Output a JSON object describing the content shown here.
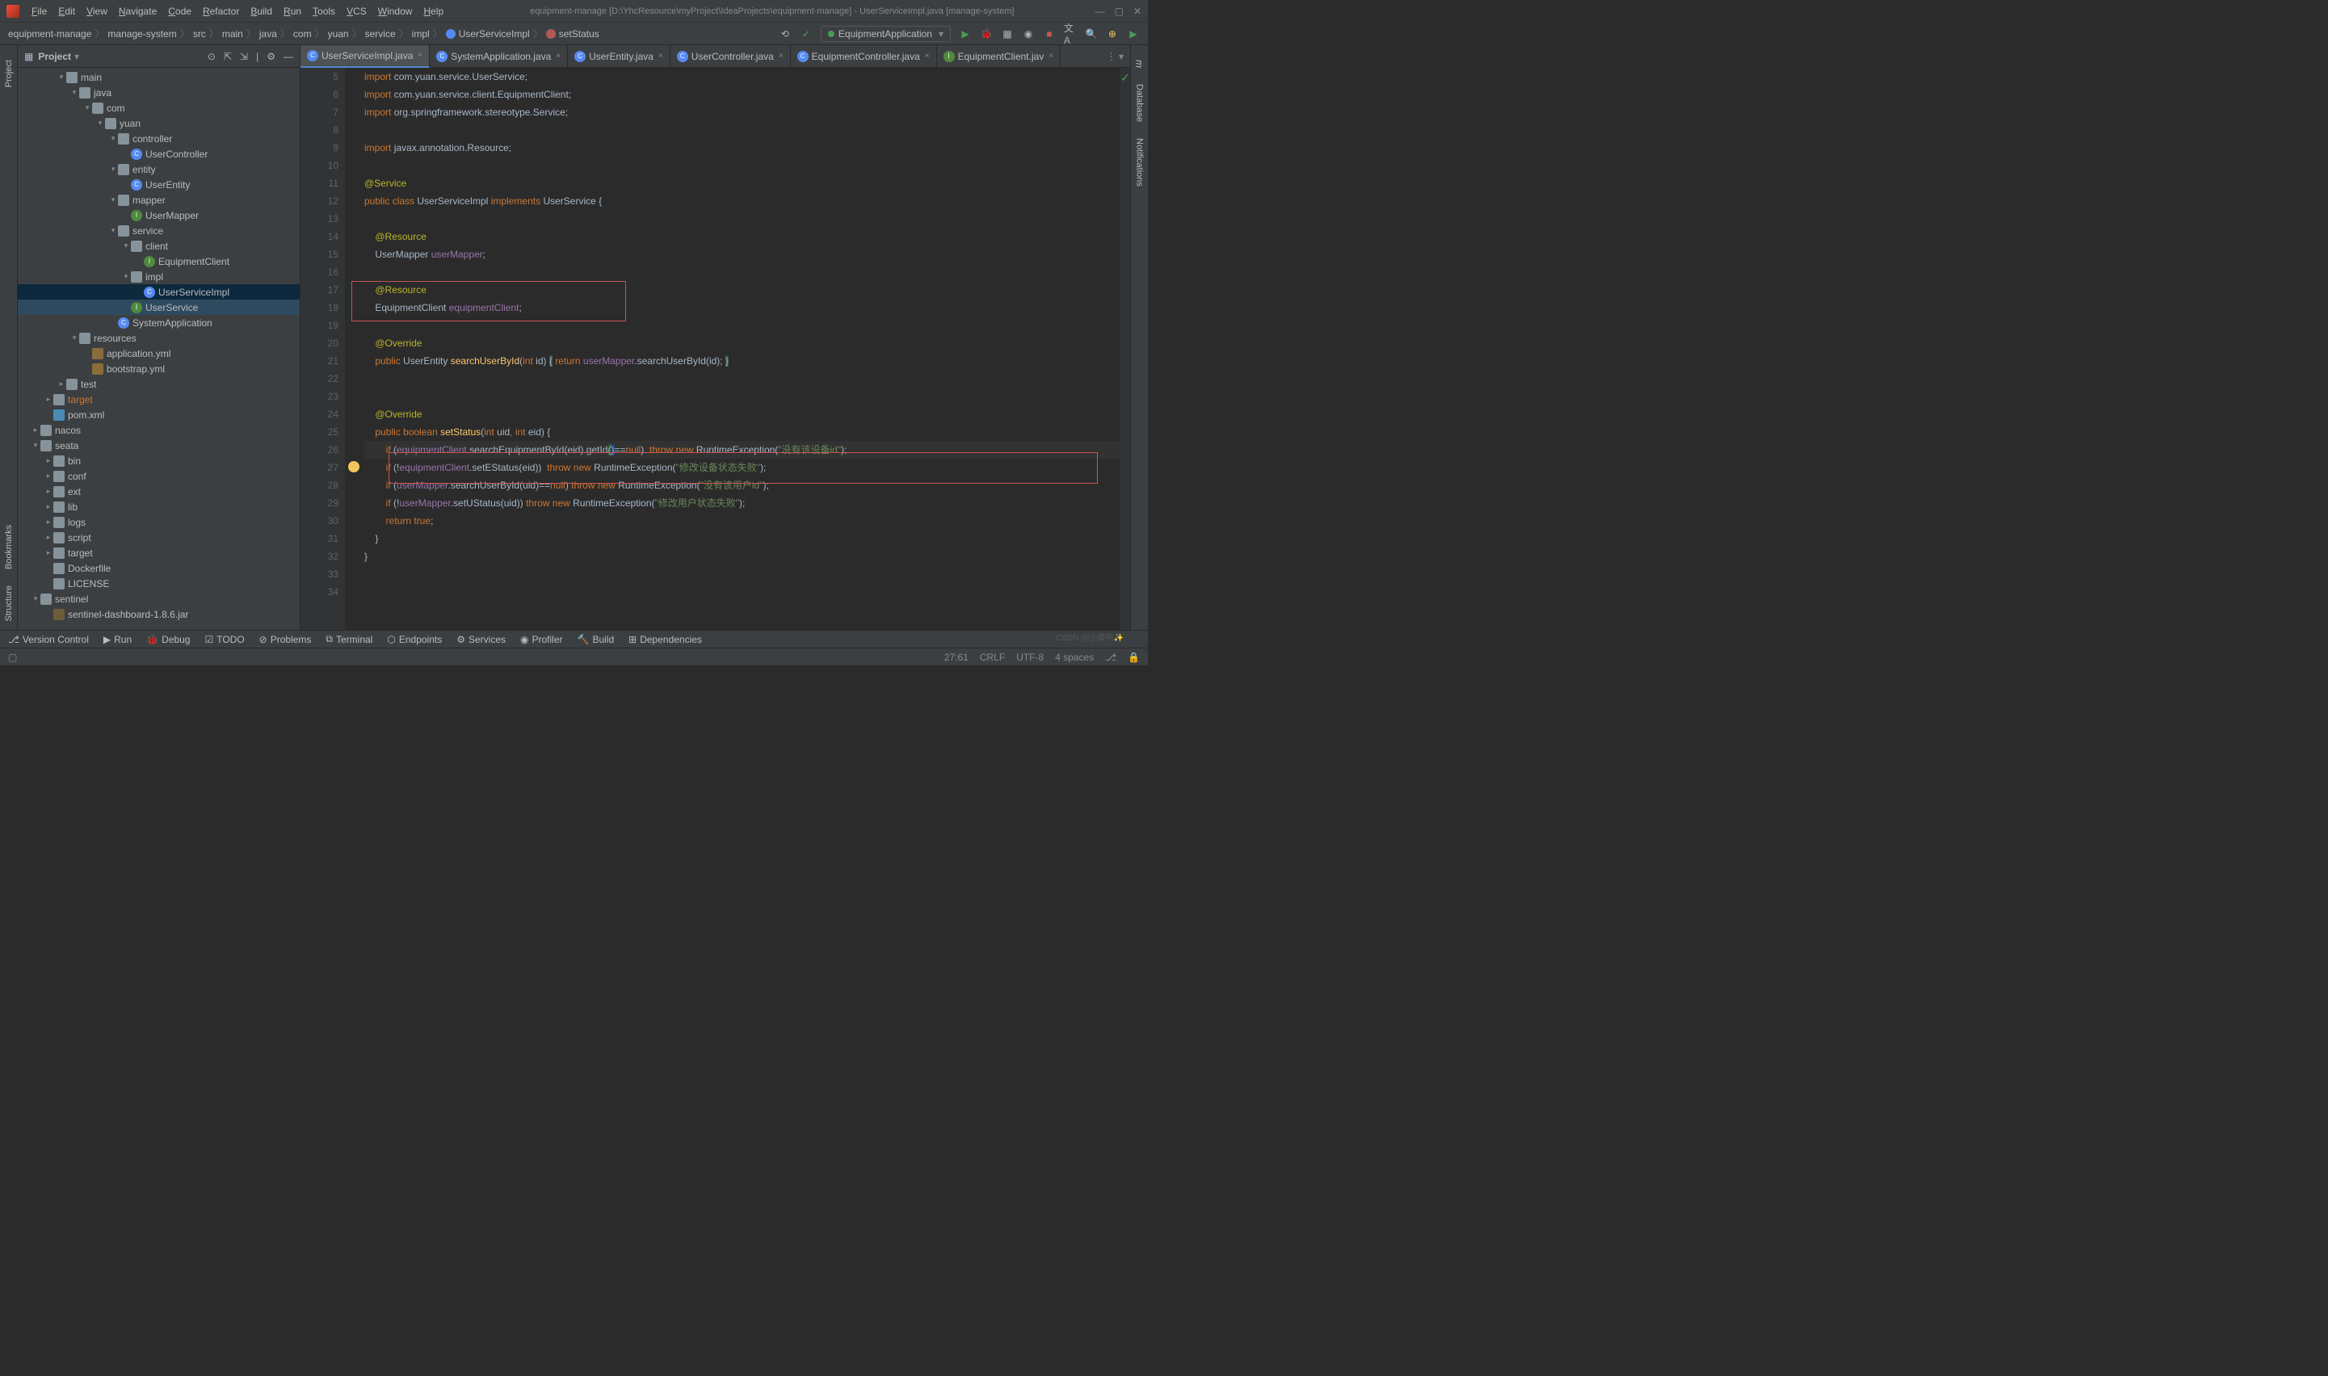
{
  "menu": [
    "File",
    "Edit",
    "View",
    "Navigate",
    "Code",
    "Refactor",
    "Build",
    "Run",
    "Tools",
    "VCS",
    "Window",
    "Help"
  ],
  "title": "equipment-manage [D:\\YhcResource\\myProject\\IdeaProjects\\equipment-manage] - UserServiceImpl.java [manage-system]",
  "breadcrumb": [
    "equipment-manage",
    "manage-system",
    "src",
    "main",
    "java",
    "com",
    "yuan",
    "service",
    "impl",
    "UserServiceImpl",
    "setStatus"
  ],
  "runConfig": "EquipmentApplication",
  "panel": {
    "title": "Project"
  },
  "tree": [
    {
      "d": 3,
      "e": "▾",
      "i": "folder-open",
      "t": "main"
    },
    {
      "d": 4,
      "e": "▾",
      "i": "folder",
      "t": "java"
    },
    {
      "d": 5,
      "e": "▾",
      "i": "pkg",
      "t": "com"
    },
    {
      "d": 6,
      "e": "▾",
      "i": "pkg",
      "t": "yuan"
    },
    {
      "d": 7,
      "e": "▾",
      "i": "pkg",
      "t": "controller"
    },
    {
      "d": 8,
      "e": "",
      "i": "class-c",
      "t": "UserController"
    },
    {
      "d": 7,
      "e": "▾",
      "i": "pkg",
      "t": "entity"
    },
    {
      "d": 8,
      "e": "",
      "i": "class-c",
      "t": "UserEntity"
    },
    {
      "d": 7,
      "e": "▾",
      "i": "pkg",
      "t": "mapper"
    },
    {
      "d": 8,
      "e": "",
      "i": "class-i",
      "t": "UserMapper"
    },
    {
      "d": 7,
      "e": "▾",
      "i": "pkg",
      "t": "service"
    },
    {
      "d": 8,
      "e": "▾",
      "i": "pkg",
      "t": "client"
    },
    {
      "d": 9,
      "e": "",
      "i": "class-i",
      "t": "EquipmentClient"
    },
    {
      "d": 8,
      "e": "▾",
      "i": "pkg",
      "t": "impl"
    },
    {
      "d": 9,
      "e": "",
      "i": "class-c",
      "t": "UserServiceImpl",
      "sel": true
    },
    {
      "d": 8,
      "e": "",
      "i": "class-i",
      "t": "UserService",
      "lite": true
    },
    {
      "d": 7,
      "e": "",
      "i": "class-c",
      "t": "SystemApplication"
    },
    {
      "d": 4,
      "e": "▾",
      "i": "folder",
      "t": "resources"
    },
    {
      "d": 5,
      "e": "",
      "i": "yml",
      "t": "application.yml"
    },
    {
      "d": 5,
      "e": "",
      "i": "yml",
      "t": "bootstrap.yml"
    },
    {
      "d": 3,
      "e": "▸",
      "i": "folder-open",
      "t": "test"
    },
    {
      "d": 2,
      "e": "▸",
      "i": "folder",
      "t": "target",
      "tgt": true
    },
    {
      "d": 2,
      "e": "",
      "i": "xml",
      "t": "pom.xml"
    },
    {
      "d": 1,
      "e": "▸",
      "i": "folder-open",
      "t": "nacos"
    },
    {
      "d": 1,
      "e": "▾",
      "i": "folder-open",
      "t": "seata"
    },
    {
      "d": 2,
      "e": "▸",
      "i": "folder-open",
      "t": "bin"
    },
    {
      "d": 2,
      "e": "▸",
      "i": "folder-open",
      "t": "conf"
    },
    {
      "d": 2,
      "e": "▸",
      "i": "folder-open",
      "t": "ext"
    },
    {
      "d": 2,
      "e": "▸",
      "i": "folder-open",
      "t": "lib"
    },
    {
      "d": 2,
      "e": "▸",
      "i": "folder-open",
      "t": "logs"
    },
    {
      "d": 2,
      "e": "▸",
      "i": "folder-open",
      "t": "script"
    },
    {
      "d": 2,
      "e": "▸",
      "i": "folder-open",
      "t": "target"
    },
    {
      "d": 2,
      "e": "",
      "i": "folder-open",
      "t": "Dockerfile"
    },
    {
      "d": 2,
      "e": "",
      "i": "folder-open",
      "t": "LICENSE"
    },
    {
      "d": 1,
      "e": "▾",
      "i": "folder-open",
      "t": "sentinel"
    },
    {
      "d": 2,
      "e": "",
      "i": "jar",
      "t": "sentinel-dashboard-1.8.6.jar"
    }
  ],
  "tabs": [
    {
      "t": "UserServiceImpl.java",
      "i": "class-c",
      "active": true
    },
    {
      "t": "SystemApplication.java",
      "i": "class-c"
    },
    {
      "t": "UserEntity.java",
      "i": "class-c"
    },
    {
      "t": "UserController.java",
      "i": "class-c"
    },
    {
      "t": "EquipmentController.java",
      "i": "class-c"
    },
    {
      "t": "EquipmentClient.jav",
      "i": "class-i"
    }
  ],
  "lines": [
    5,
    6,
    7,
    8,
    9,
    10,
    11,
    12,
    13,
    14,
    15,
    16,
    17,
    18,
    19,
    20,
    21,
    22,
    23,
    24,
    25,
    26,
    27,
    28,
    29,
    30,
    31,
    32,
    33,
    34
  ],
  "tools": [
    "Version Control",
    "Run",
    "Debug",
    "TODO",
    "Problems",
    "Terminal",
    "Endpoints",
    "Services",
    "Profiler",
    "Build",
    "Dependencies"
  ],
  "status": {
    "pos": "27:61",
    "le": "CRLF",
    "enc": "UTF-8",
    "indent": "4 spaces"
  },
  "rails": {
    "left": [
      "Project",
      "Bookmarks",
      "Structure"
    ],
    "right": [
      "Maven",
      "Database",
      "Notifications"
    ]
  },
  "watermark": "CSDN @小黄鸭✨"
}
